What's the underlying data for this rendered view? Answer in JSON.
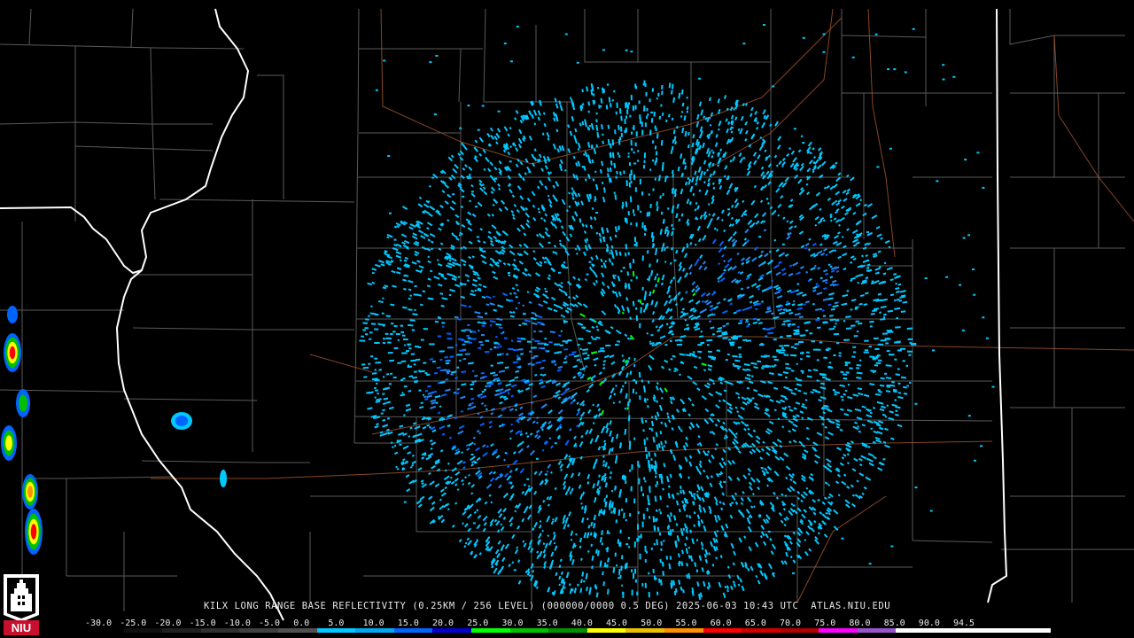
{
  "caption": "KILX LONG RANGE BASE REFLECTIVITY (0.25KM / 256 LEVEL) (000000/0000 0.5 DEG) 2025-06-03 10:43 UTC  ATLAS.NIU.EDU",
  "colorbar": {
    "ticks": [
      "-30.0",
      "-25.0",
      "-20.0",
      "-15.0",
      "-10.0",
      "-5.0",
      "0.0",
      "5.0",
      "10.0",
      "15.0",
      "20.0",
      "25.0",
      "30.0",
      "35.0",
      "40.0",
      "45.0",
      "50.0",
      "55.0",
      "60.0",
      "65.0",
      "70.0",
      "75.0",
      "80.0",
      "85.0",
      "90.0",
      "94.5"
    ],
    "colors": [
      "#000000",
      "#101010",
      "#202020",
      "#303030",
      "#404040",
      "#505050",
      "#00c8ff",
      "#00a8f0",
      "#0064ff",
      "#0000c8",
      "#00ff00",
      "#00c000",
      "#009000",
      "#ffff00",
      "#e8c000",
      "#ff9000",
      "#ff0000",
      "#d00000",
      "#b00000",
      "#ff00ff",
      "#9955c9",
      "#ffffff",
      "#ffffff",
      "#ffffff",
      "#ffffff"
    ]
  },
  "logo": {
    "text": "NIU",
    "color": "#c8102e"
  },
  "map": {
    "background": "#000000",
    "county_line_color": "#5a5a5a",
    "state_line_color": "#ffffff",
    "highway_color": "#a0522d",
    "radar_site": "KILX",
    "echo_colors": [
      "#00c8ff",
      "#2288ee",
      "#0064ff",
      "#00ff00",
      "#ffff00",
      "#ff0000"
    ]
  }
}
